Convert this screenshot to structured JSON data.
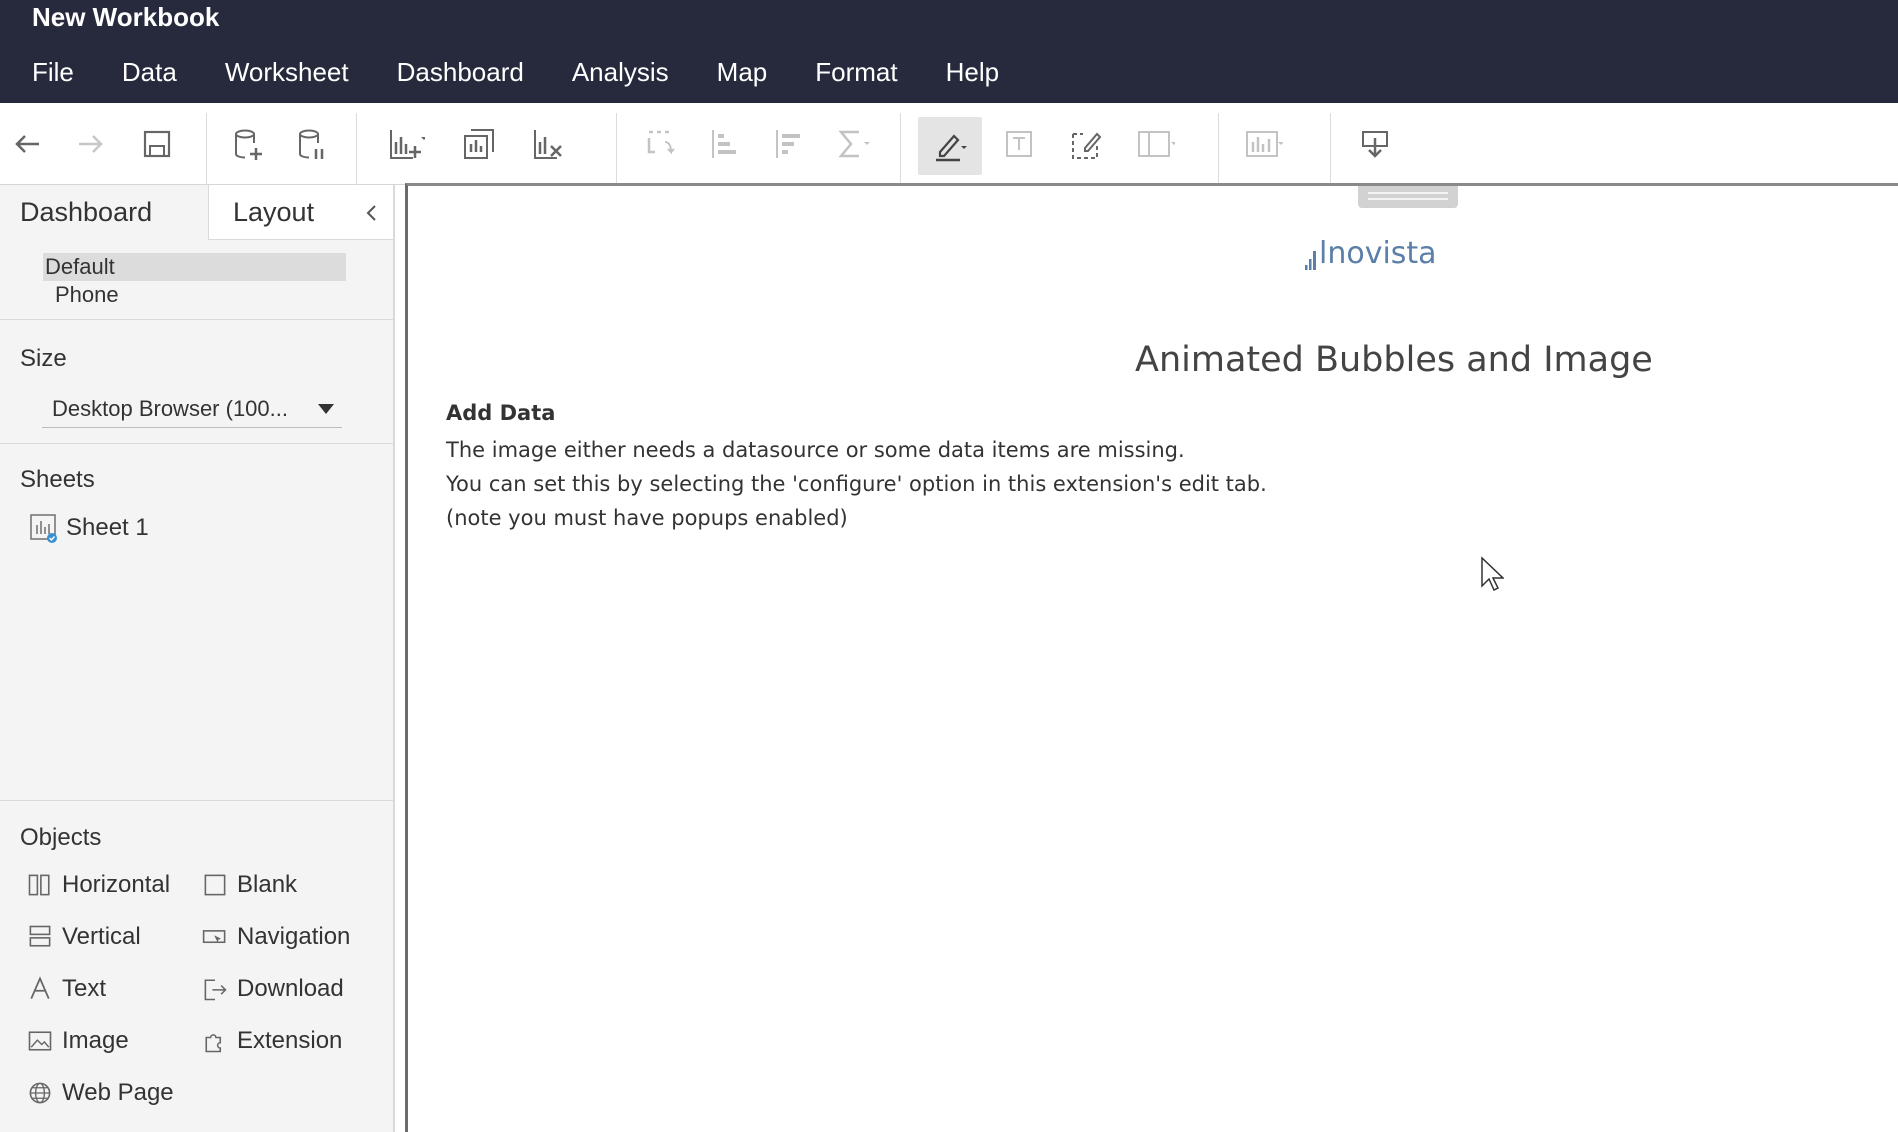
{
  "window": {
    "title": "New Workbook"
  },
  "menu": [
    "File",
    "Data",
    "Worksheet",
    "Dashboard",
    "Analysis",
    "Map",
    "Format",
    "Help"
  ],
  "toolbar": {
    "buttons": [
      "back-icon",
      "forward-icon",
      "save-icon",
      "new-datasource-icon",
      "pause-updates-icon",
      "new-worksheet-icon",
      "duplicate-sheet-icon",
      "clear-sheet-icon",
      "swap-icon",
      "sort-ascending-icon",
      "sort-descending-icon",
      "totals-icon",
      "highlight-icon",
      "labels-icon",
      "annotate-icon",
      "fit-icon",
      "show-me-icon",
      "present-icon"
    ]
  },
  "left_pane": {
    "tabs": {
      "dashboard": "Dashboard",
      "layout": "Layout"
    },
    "devices": {
      "default": "Default",
      "phone": "Phone"
    },
    "size": {
      "title": "Size",
      "selected": "Desktop Browser (100..."
    },
    "sheets": {
      "title": "Sheets",
      "items": [
        {
          "label": "Sheet 1"
        }
      ]
    },
    "objects": {
      "title": "Objects",
      "items": [
        {
          "label": "Horizontal",
          "icon": "horizontal-container-icon"
        },
        {
          "label": "Blank",
          "icon": "blank-icon"
        },
        {
          "label": "Vertical",
          "icon": "vertical-container-icon"
        },
        {
          "label": "Navigation",
          "icon": "navigation-icon"
        },
        {
          "label": "Text",
          "icon": "text-icon"
        },
        {
          "label": "Download",
          "icon": "download-icon"
        },
        {
          "label": "Image",
          "icon": "image-icon"
        },
        {
          "label": "Extension",
          "icon": "extension-icon"
        },
        {
          "label": "Web Page",
          "icon": "globe-icon"
        }
      ]
    }
  },
  "canvas": {
    "logo": "lnovista",
    "title": "Animated Bubbles and Image",
    "add_data": {
      "heading": "Add Data",
      "lines": [
        "The image either needs a datasource or some data items are missing.",
        "You can set this by selecting the 'configure' option in this extension's edit tab.",
        "(note you must have popups enabled)"
      ]
    }
  },
  "colors": {
    "titlebar": "#262a3c",
    "accent": "#5b7fa8",
    "sheet_badge": "#3a8fd1"
  }
}
